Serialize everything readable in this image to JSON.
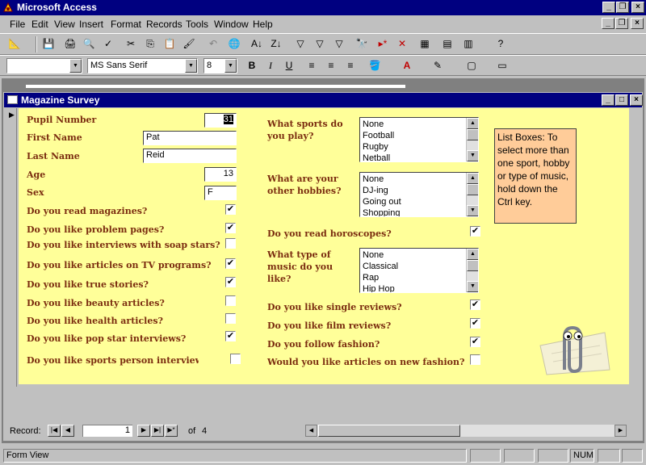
{
  "app": {
    "title": "Microsoft Access"
  },
  "menu": [
    "File",
    "Edit",
    "View",
    "Insert",
    "Format",
    "Records",
    "Tools",
    "Window",
    "Help"
  ],
  "format_toolbar": {
    "object_combo": "",
    "font_name": "MS Sans Serif",
    "font_size": "8"
  },
  "form": {
    "title": "Magazine Survey",
    "fields": {
      "pupil_number": {
        "label": "Pupil Number",
        "value": "31"
      },
      "first_name": {
        "label": "First Name",
        "value": "Pat"
      },
      "last_name": {
        "label": "Last Name",
        "value": "Reid"
      },
      "age": {
        "label": "Age",
        "value": "13"
      },
      "sex": {
        "label": "Sex",
        "value": "F"
      }
    },
    "left_checks": [
      {
        "label": "Do you read magazines?",
        "checked": true
      },
      {
        "label": "Do you like problem pages?",
        "checked": true
      },
      {
        "label": "Do you like interviews with soap stars?",
        "checked": false
      },
      {
        "label": "Do you like articles on TV programs?",
        "checked": true
      },
      {
        "label": "Do you like true stories?",
        "checked": true
      },
      {
        "label": "Do you like beauty articles?",
        "checked": false
      },
      {
        "label": "Do you like health articles?",
        "checked": false
      },
      {
        "label": "Do you like pop star interviews?",
        "checked": true
      },
      {
        "label": "Do you like sports person interview",
        "checked": false
      }
    ],
    "lists": {
      "sports": {
        "label": "What sports do you play?",
        "options": [
          "None",
          "Football",
          "Rugby",
          "Netball"
        ]
      },
      "hobbies": {
        "label": "What are your other hobbies?",
        "options": [
          "None",
          "DJ-ing",
          "Going out",
          "Shopping"
        ]
      },
      "music": {
        "label": "What type of music do you like?",
        "options": [
          "None",
          "Classical",
          "Rap",
          "Hip Hop"
        ]
      }
    },
    "right_checks": {
      "horoscopes": {
        "label": "Do you read horoscopes?",
        "checked": true
      },
      "singles": {
        "label": "Do you like single reviews?",
        "checked": true
      },
      "films": {
        "label": "Do you like film reviews?",
        "checked": true
      },
      "fashion": {
        "label": "Do you follow fashion?",
        "checked": true
      },
      "new_fashion": {
        "label": "Would you like articles on new fashion?",
        "checked": false
      }
    },
    "note": "List Boxes: To select more than one sport, hobby or type of music, hold down the Ctrl key."
  },
  "navigation": {
    "record_label": "Record:",
    "current": "1",
    "of_label": "of",
    "total": "4"
  },
  "status": {
    "mode": "Form View",
    "num": "NUM"
  },
  "colors": {
    "titlebar": "#000080",
    "form_bg": "#ffff99",
    "label_color": "#7b2d10",
    "note_bg": "#ffcc99"
  }
}
